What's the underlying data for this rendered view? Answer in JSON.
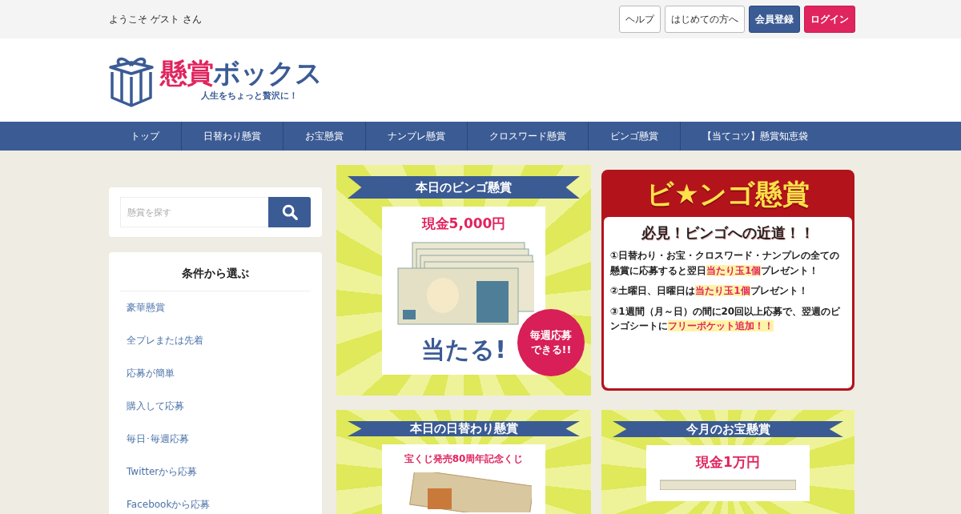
{
  "top_bar": {
    "greeting": "ようこそ ゲスト さん",
    "buttons": [
      {
        "label": "ヘルプ",
        "kind": "outline"
      },
      {
        "label": "はじめての方へ",
        "kind": "outline"
      },
      {
        "label": "会員登録",
        "kind": "primary"
      },
      {
        "label": "ログイン",
        "kind": "accent"
      }
    ]
  },
  "logo": {
    "title_parts": [
      "懸賞",
      "ボックス"
    ],
    "tagline": "人生をちょっと贅沢に！"
  },
  "nav": [
    "トップ",
    "日替わり懸賞",
    "お宝懸賞",
    "ナンプレ懸賞",
    "クロスワード懸賞",
    "ビンゴ懸賞",
    "【当てコツ】懸賞知恵袋"
  ],
  "sidebar": {
    "search": {
      "placeholder": "懸賞を探す"
    },
    "categories": {
      "title": "条件から選ぶ",
      "items": [
        "豪華懸賞",
        "全プレまたは先着",
        "応募が簡単",
        "購入して応募",
        "毎日･毎週応募",
        "Twitterから応募",
        "Facebookから応募"
      ]
    }
  },
  "cards": [
    {
      "kind": "prize",
      "title": "本日のビンゴ懸賞",
      "prize": "現金5,000円",
      "caption": "当たる!",
      "badge": "毎週応募できる!!"
    },
    {
      "kind": "bingo_info",
      "title": "ビ★ンゴ懸賞",
      "heading": "必見！ビンゴへの近道！！",
      "rules": [
        {
          "mark": "①",
          "parts": [
            {
              "text": "日替わり・お宝・クロスワード・ナンプレの全ての懸賞に応募すると翌日",
              "highlight": false
            },
            {
              "text": "当たり玉1個",
              "highlight": true
            },
            {
              "text": "プレゼント！",
              "highlight": false
            }
          ]
        },
        {
          "mark": "②",
          "parts": [
            {
              "text": "土曜日、日曜日は",
              "highlight": false
            },
            {
              "text": "当たり玉1個",
              "highlight": true
            },
            {
              "text": "プレゼント！",
              "highlight": false
            }
          ]
        },
        {
          "mark": "③",
          "parts": [
            {
              "text": "1週間（月～日）の間に20回以上応募で、翌週のビンゴシートに",
              "highlight": false
            },
            {
              "text": "フリーポケット追加！！",
              "highlight": true
            }
          ]
        }
      ]
    },
    {
      "kind": "prize",
      "title": "本日の日替わり懸賞",
      "prize": "宝くじ発売80周年記念くじ"
    },
    {
      "kind": "prize",
      "title": "今月のお宝懸賞",
      "prize": "現金1万円"
    }
  ]
}
